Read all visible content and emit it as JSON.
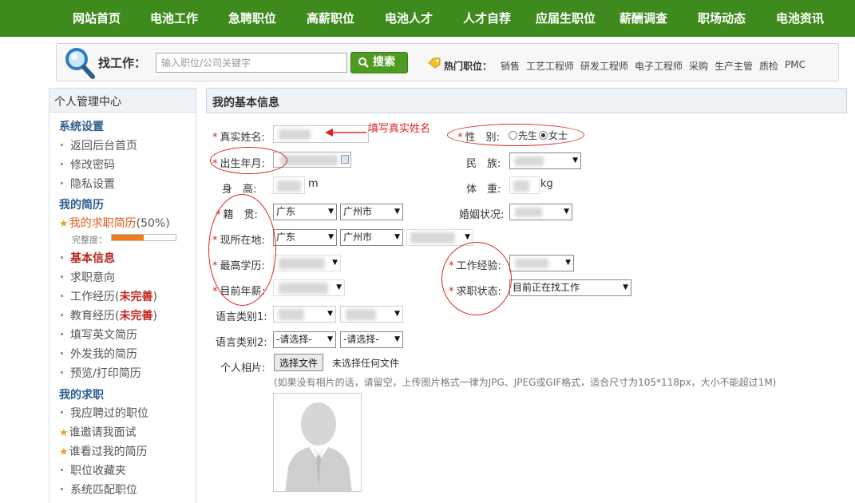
{
  "nav": [
    "网站首页",
    "电池工作",
    "急聘职位",
    "高薪职位",
    "电池人才",
    "人才自荐",
    "应届生职位",
    "薪酬调查",
    "职场动态",
    "电池资讯"
  ],
  "search": {
    "label": "找工作：",
    "placeholder": "输入职位/公司关键字",
    "button": "搜索",
    "hot_label": "热门职位：",
    "hot": [
      "销售",
      "工艺工程师",
      "研发工程师",
      "电子工程师",
      "采购",
      "生产主管",
      "质检",
      "PMC"
    ]
  },
  "sidebar": {
    "title": "个人管理中心",
    "sections": [
      {
        "title": "系统设置",
        "items": [
          "返回后台首页",
          "修改密码",
          "隐私设置"
        ]
      },
      {
        "title": "我的简历",
        "resume": "我的求职简历",
        "percent": "(50%)",
        "completeness_label": "完整度：",
        "completeness": 0.5,
        "items": [
          "基本信息",
          "求职意向",
          "工作经历",
          "教育经历",
          "填写英文简历",
          "外发我的简历",
          "预览/打印简历"
        ],
        "incomplete": "未完善"
      },
      {
        "title": "我的求职",
        "items": [
          "我应聘过的职位",
          "谁邀请我面试",
          "谁看过我的简历",
          "职位收藏夹",
          "系统匹配职位"
        ]
      }
    ]
  },
  "form": {
    "header": "我的基本信息",
    "annotation": "填写真实姓名",
    "labels": {
      "name": "真实姓名:",
      "gender": "性　别:",
      "birth": "出生年月:",
      "ethnic": "民　族:",
      "height": "身　高:",
      "weight": "体　重:",
      "native": "籍　贯:",
      "marital": "婚姻状况:",
      "location": "现所在地:",
      "education": "最高学历:",
      "experience": "工作经验:",
      "salary": "目前年薪:",
      "status": "求职状态:",
      "lang1": "语言类别1:",
      "lang2": "语言类别2:",
      "photo": "个人相片:"
    },
    "gender_options": [
      "先生",
      "女士"
    ],
    "height_unit": "m",
    "weight_unit": "kg",
    "native_province": "广东",
    "native_city": "广州市",
    "location_province": "广东",
    "location_city": "广州市",
    "status_value": "目前正在找工作",
    "select_prompt": "-请选择-",
    "file_button": "选择文件",
    "file_status": "未选择任何文件",
    "photo_hint": "(如果没有相片的话，请留空，上传图片格式一律为JPG、JPEG或GIF格式，适合尺寸为105*118px，大小不能超过1M)"
  },
  "colors": {
    "nav_bg": "#3e8a1c",
    "link_blue": "#2d5d90",
    "required_red": "#d9231d",
    "annotation_red": "#dd2222"
  }
}
